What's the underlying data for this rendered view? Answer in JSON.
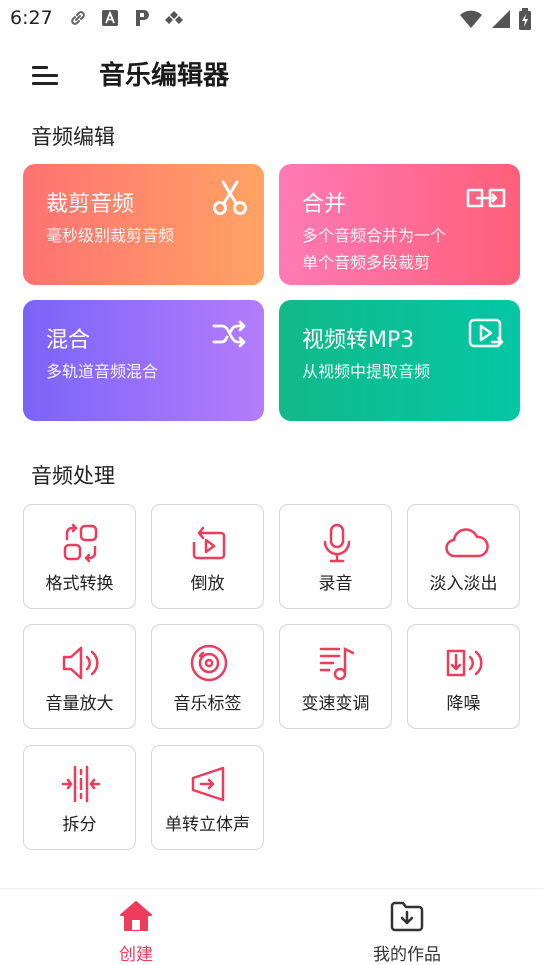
{
  "status_bar": {
    "time": "6:27"
  },
  "app_bar": {
    "title": "音乐编辑器"
  },
  "audio_edit": {
    "title": "音频编辑",
    "cards": [
      {
        "title": "裁剪音频",
        "desc": "毫秒级别裁剪音频",
        "icon": "scissors-icon"
      },
      {
        "title": "合并",
        "desc": "多个音频合并为一个\n单个音频多段裁剪",
        "icon": "merge-icon"
      },
      {
        "title": "混合",
        "desc": "多轨道音频混合",
        "icon": "shuffle-icon"
      },
      {
        "title": "视频转MP3",
        "desc": "从视频中提取音频",
        "icon": "video-to-audio-icon"
      }
    ]
  },
  "audio_process": {
    "title": "音频处理",
    "tools": [
      {
        "label": "格式转换",
        "icon": "format-convert-icon"
      },
      {
        "label": "倒放",
        "icon": "reverse-play-icon"
      },
      {
        "label": "录音",
        "icon": "microphone-icon"
      },
      {
        "label": "淡入淡出",
        "icon": "cloud-icon"
      },
      {
        "label": "音量放大",
        "icon": "volume-icon"
      },
      {
        "label": "音乐标签",
        "icon": "disc-icon"
      },
      {
        "label": "变速变调",
        "icon": "music-note-icon"
      },
      {
        "label": "降噪",
        "icon": "noise-reduction-icon"
      },
      {
        "label": "拆分",
        "icon": "split-icon"
      },
      {
        "label": "单转立体声",
        "icon": "stereo-icon"
      }
    ]
  },
  "bottom_nav": {
    "items": [
      {
        "label": "创建",
        "icon": "home-icon",
        "active": true
      },
      {
        "label": "我的作品",
        "icon": "download-folder-icon",
        "active": false
      }
    ]
  },
  "colors": {
    "accent": "#ef3b5c",
    "card_cut": [
      "#ff7272",
      "#ffa364"
    ],
    "card_merge": [
      "#ff7ab5",
      "#ff5f79"
    ],
    "card_mix": [
      "#7a64f8",
      "#b47dfb"
    ],
    "card_video": [
      "#12b98a",
      "#05c6a5"
    ]
  }
}
